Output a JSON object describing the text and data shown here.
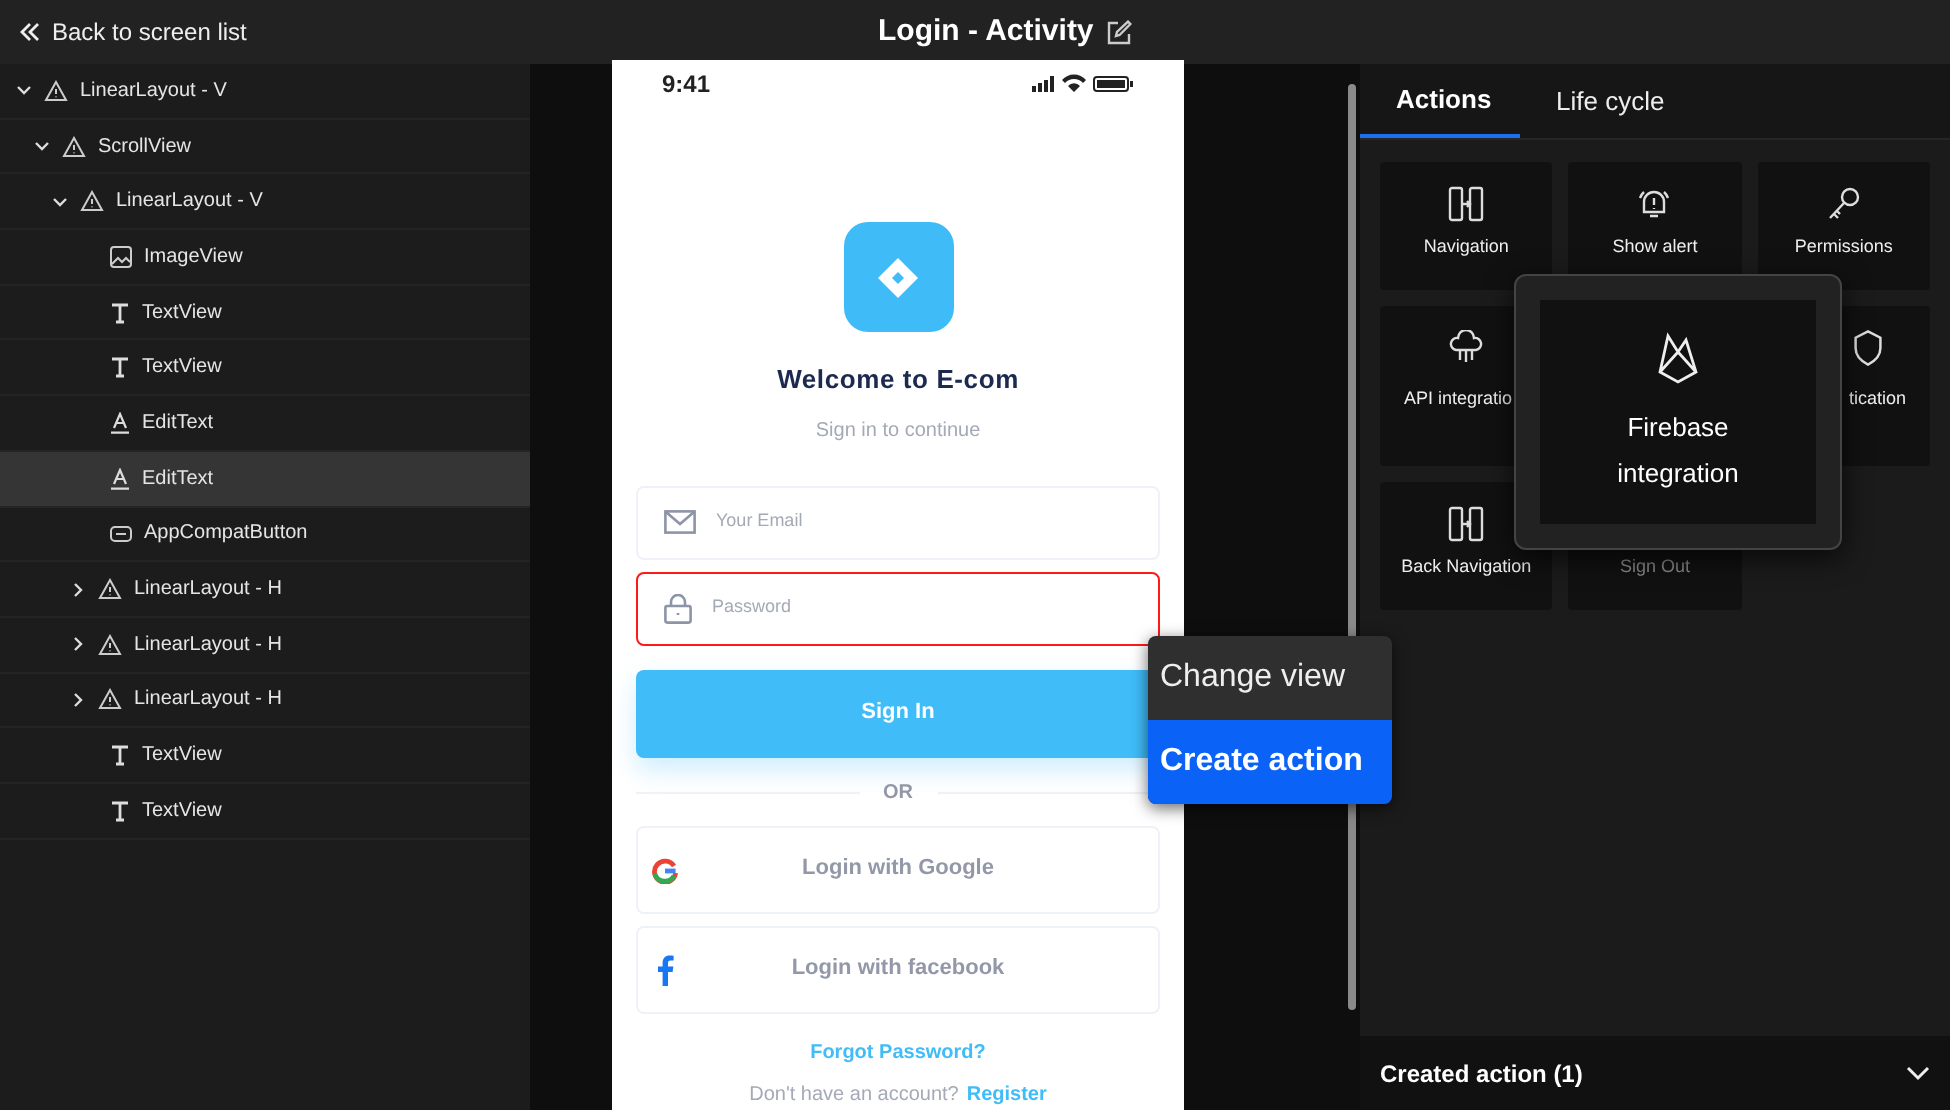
{
  "header": {
    "back": "Back to screen list",
    "title": "Login - Activity"
  },
  "tree": [
    {
      "label": "LinearLayout - V",
      "kind": "layout",
      "expanded": true,
      "selected": false,
      "children": [
        {
          "label": "ScrollView",
          "kind": "layout",
          "expanded": true,
          "selected": false,
          "children": [
            {
              "label": "LinearLayout - V",
              "kind": "layout",
              "expanded": true,
              "selected": false,
              "children": [
                {
                  "label": "ImageView",
                  "kind": "image",
                  "selected": false
                },
                {
                  "label": "TextView",
                  "kind": "text",
                  "selected": false
                },
                {
                  "label": "TextView",
                  "kind": "text",
                  "selected": false
                },
                {
                  "label": "EditText",
                  "kind": "edit",
                  "selected": false
                },
                {
                  "label": "EditText",
                  "kind": "edit",
                  "selected": true
                },
                {
                  "label": "AppCompatButton",
                  "kind": "button",
                  "selected": false
                },
                {
                  "label": "LinearLayout - H",
                  "kind": "layout",
                  "expanded": false,
                  "selected": false
                },
                {
                  "label": "LinearLayout - H",
                  "kind": "layout",
                  "expanded": false,
                  "selected": false
                },
                {
                  "label": "LinearLayout - H",
                  "kind": "layout",
                  "expanded": false,
                  "selected": false
                },
                {
                  "label": "TextView",
                  "kind": "text",
                  "selected": false
                },
                {
                  "label": "TextView",
                  "kind": "text",
                  "selected": false
                }
              ]
            }
          ]
        }
      ]
    }
  ],
  "phone": {
    "time": "9:41",
    "welcome": "Welcome to E-com",
    "subtitle": "Sign in to continue",
    "fields": [
      {
        "kind": "email",
        "placeholder": "Your Email",
        "selected": false
      },
      {
        "kind": "password",
        "placeholder": "Password",
        "selected": true
      }
    ],
    "sign_in": "Sign In",
    "or": "OR",
    "social": [
      {
        "kind": "google",
        "label": "Login with Google"
      },
      {
        "kind": "facebook",
        "label": "Login with facebook"
      }
    ],
    "forgot": "Forgot Password?",
    "no_account": "Don't have an account?",
    "register": "Register"
  },
  "context_menu": [
    {
      "label": "Change view",
      "selected": false
    },
    {
      "label": "Create action",
      "selected": true
    }
  ],
  "tabs": [
    {
      "label": "Actions",
      "selected": true
    },
    {
      "label": "Life cycle",
      "selected": false
    }
  ],
  "actions": [
    {
      "label": "Navigation",
      "kind": "navigation"
    },
    {
      "label": "Show alert",
      "kind": "alert"
    },
    {
      "label": "Permissions",
      "kind": "key"
    },
    {
      "label": "API integratio",
      "kind": "api"
    },
    {
      "kind": "hidden"
    },
    {
      "label": "tication",
      "kind": "shield"
    },
    {
      "label": "Back Navigation",
      "kind": "navigation"
    },
    {
      "label": "Sign Out",
      "kind": "signout"
    }
  ],
  "drag_tile": {
    "label": "Firebase integration"
  },
  "created": {
    "label": "Created action (1)",
    "expanded": false
  }
}
